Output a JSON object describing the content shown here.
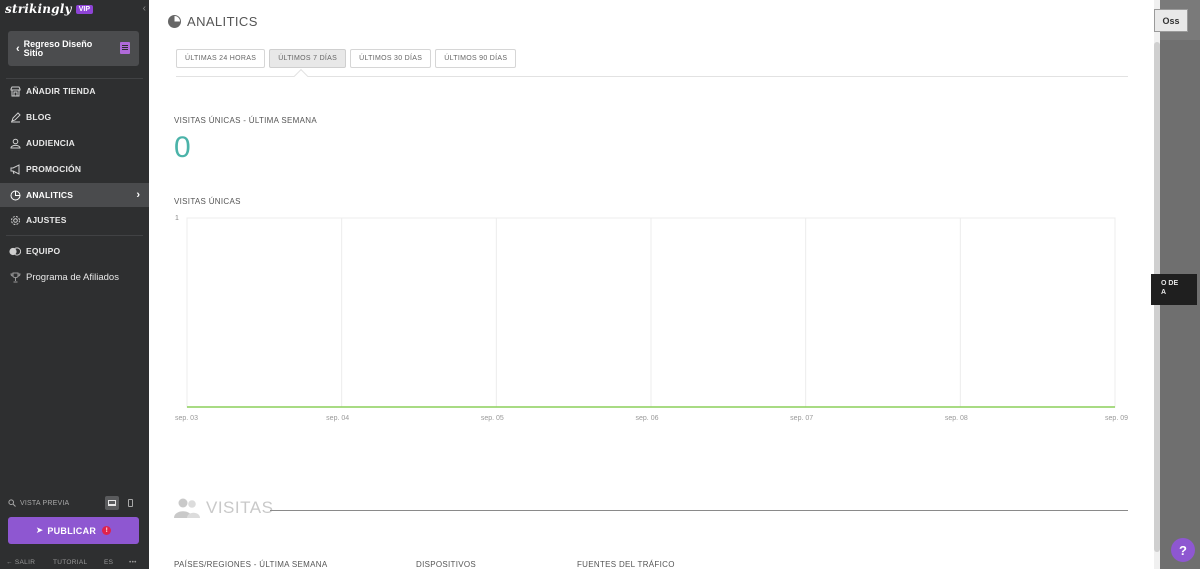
{
  "sidebar": {
    "logo": "strikingly",
    "vip_badge": "VIP",
    "back_button": "Regreso Diseño Sitio",
    "items": [
      {
        "label": "AÑADIR TIENDA",
        "icon": "store-icon"
      },
      {
        "label": "BLOG",
        "icon": "pen-icon"
      },
      {
        "label": "AUDIENCIA",
        "icon": "audience-icon"
      },
      {
        "label": "PROMOCIÓN",
        "icon": "megaphone-icon"
      },
      {
        "label": "ANALITICS",
        "icon": "pie-chart-icon",
        "active": true
      },
      {
        "label": "AJUSTES",
        "icon": "gear-icon"
      },
      {
        "label": "EQUIPO",
        "icon": "team-icon"
      },
      {
        "label": "Programa de Afiliados",
        "icon": "trophy-icon"
      }
    ],
    "preview_label": "VISTA PREVIA",
    "publish_label": "PUBLICAR",
    "publish_badge": "!",
    "footer": {
      "salir": "← SALIR",
      "tutorial": "TUTORIAL",
      "lang": "ES",
      "more": "•••"
    }
  },
  "main": {
    "title": "ANALITICS",
    "tabs": [
      {
        "label": "ÚLTIMAS 24 HORAS"
      },
      {
        "label": "ÚLTIMOS 7 DÍAS",
        "active": true
      },
      {
        "label": "ÚLTIMOS 30 DÍAS"
      },
      {
        "label": "ÚLTIMOS 90 DÍAS"
      }
    ],
    "unique_visits_label": "VISITAS ÚNICAS - ÚLTIMA SEMANA",
    "unique_visits_value": "0",
    "chart_heading": "VISITAS ÚNICAS",
    "visitas_section": "VISITAS",
    "columns": [
      "PAÍSES/REGIONES - ÚLTIMA SEMANA",
      "DISPOSITIVOS",
      "FUENTES DEL TRÁFICO"
    ]
  },
  "chart_data": {
    "type": "line",
    "title": "VISITAS ÚNICAS",
    "categories": [
      "sep. 03",
      "sep. 04",
      "sep. 05",
      "sep. 06",
      "sep. 07",
      "sep. 08",
      "sep. 09"
    ],
    "series": [
      {
        "values": [
          0,
          0,
          0,
          0,
          0,
          0,
          0
        ]
      }
    ],
    "ylim": [
      0,
      1
    ],
    "y_ticks": [
      "1"
    ],
    "grid": true,
    "line_color": "#8ccf5a"
  },
  "background": {
    "oss_button": "Oss",
    "dark_box_lines": [
      "O DE",
      "A"
    ],
    "help_button": "?"
  },
  "colors": {
    "sidebar_bg": "#2e2f30",
    "accent_purple": "#8e57d1",
    "teal_number": "#4bb3a9"
  }
}
